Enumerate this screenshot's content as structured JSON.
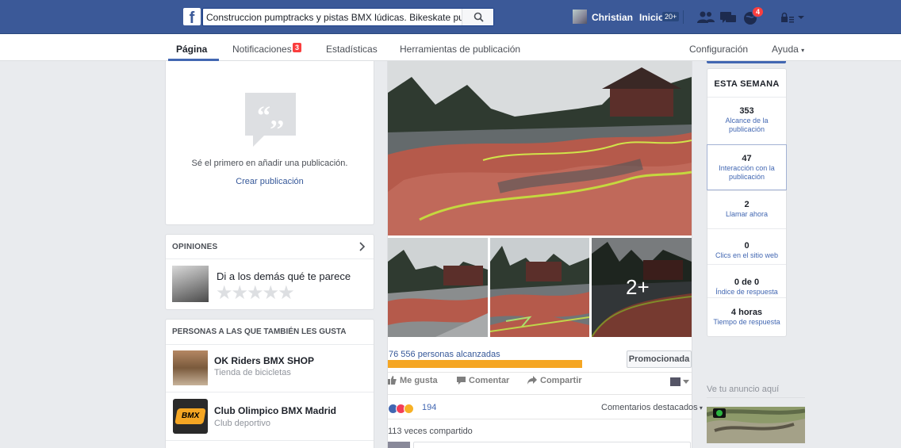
{
  "topbar": {
    "logo": "f",
    "search_value": "Construccion pumptracks y pistas BMX lúdicas. Bikeskate pum",
    "user_name": "Christian",
    "home_label": "Inicio",
    "home_badge": "20+",
    "notifications_badge": "4",
    "icons": [
      "facebook-logo-icon",
      "search-icon",
      "friend-requests-icon",
      "messages-icon",
      "notifications-globe-icon",
      "privacy-lock-icon",
      "menu-arrow-icon"
    ]
  },
  "page_nav": {
    "tabs": [
      {
        "label": "Página",
        "active": true
      },
      {
        "label": "Notificaciones",
        "badge": "3"
      },
      {
        "label": "Estadísticas"
      },
      {
        "label": "Herramientas de publicación"
      }
    ],
    "settings_label": "Configuración",
    "help_label": "Ayuda"
  },
  "composer": {
    "empty_text": "Sé el primero en añadir una publicación.",
    "create_link": "Crear publicación",
    "icon": "quote-bubble-icon"
  },
  "reviews": {
    "header": "OPINIONES",
    "prompt": "Di a los demás qué te parece",
    "stars": "★★★★★"
  },
  "likes": {
    "header": "PERSONAS A LAS QUE TAMBIÉN LES GUSTA",
    "items": [
      {
        "name": "OK Riders BMX SHOP",
        "category": "Tienda de bicicletas"
      },
      {
        "name": "Club Olimpico BMX Madrid",
        "category": "Club deportivo",
        "logo_text": "BMX"
      }
    ]
  },
  "post": {
    "more_photos": "2+",
    "reach_text": "76 556 personas alcanzadas",
    "reach_fraction": 1.0,
    "promoted_label": "Promocionada",
    "actions": {
      "like": "Me gusta",
      "comment": "Comentar",
      "share": "Compartir"
    },
    "reactions": [
      "like",
      "love",
      "wow"
    ],
    "reaction_count": "194",
    "top_comments": "Comentarios destacados",
    "shares_text": "113 veces compartido"
  },
  "this_week": {
    "title": "ESTA SEMANA",
    "stats": [
      {
        "value": "353",
        "label": "Alcance de la publicación"
      },
      {
        "value": "47",
        "label": "Interacción con la publicación"
      },
      {
        "value": "2",
        "label": "Llamar ahora"
      },
      {
        "value": "0",
        "label": "Clics en el sitio web"
      },
      {
        "value": "0 de 0",
        "label": "Índice de respuesta"
      },
      {
        "value": "4 horas",
        "label": "Tiempo de respuesta"
      }
    ]
  },
  "ad": {
    "label": "Ve tu anuncio aquí"
  },
  "colors": {
    "brand_blue": "#3b5998",
    "link_blue": "#365899",
    "reach_bar": "#f5a623",
    "badge_red": "#fa3e3e"
  }
}
